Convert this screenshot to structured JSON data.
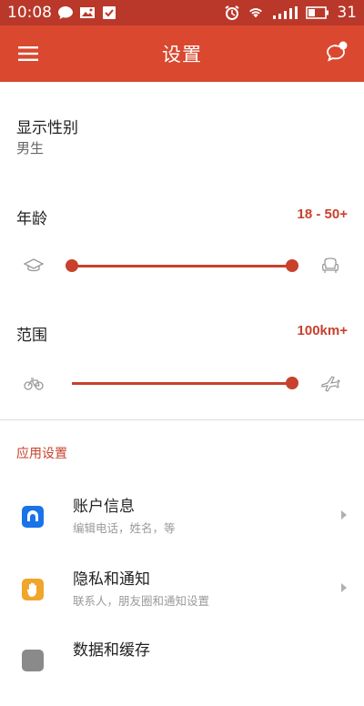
{
  "status_bar": {
    "time": "10:08",
    "battery_level": "31",
    "icons": [
      "chat-bubble-icon",
      "image-icon",
      "checkbox-icon",
      "alarm-icon",
      "wifi-icon",
      "signal-icon",
      "battery-icon"
    ]
  },
  "app_bar": {
    "title": "设置",
    "left_icon": "menu-icon",
    "right_icon": "chat-notification-icon"
  },
  "gender": {
    "title": "显示性别",
    "value": "男生"
  },
  "age": {
    "title": "年龄",
    "value": "18 - 50+",
    "left_icon": "graduation-cap-icon",
    "right_icon": "armchair-icon"
  },
  "range": {
    "title": "范围",
    "value": "100km+",
    "left_icon": "bicycle-icon",
    "right_icon": "airplane-icon"
  },
  "app_settings": {
    "header": "应用设置",
    "items": [
      {
        "title": "账户信息",
        "subtitle": "编辑电话，姓名，等",
        "icon": "account-icon",
        "color": "#1a73e8"
      },
      {
        "title": "隐私和通知",
        "subtitle": "联系人，朋友圈和通知设置",
        "icon": "hand-icon",
        "color": "#f0a52b"
      },
      {
        "title": "数据和缓存",
        "subtitle": "",
        "icon": "data-icon",
        "color": "#8a8a8a"
      }
    ]
  },
  "colors": {
    "accent": "#d9482f",
    "status_bar": "#b9382a",
    "value_text": "#c8412c"
  }
}
